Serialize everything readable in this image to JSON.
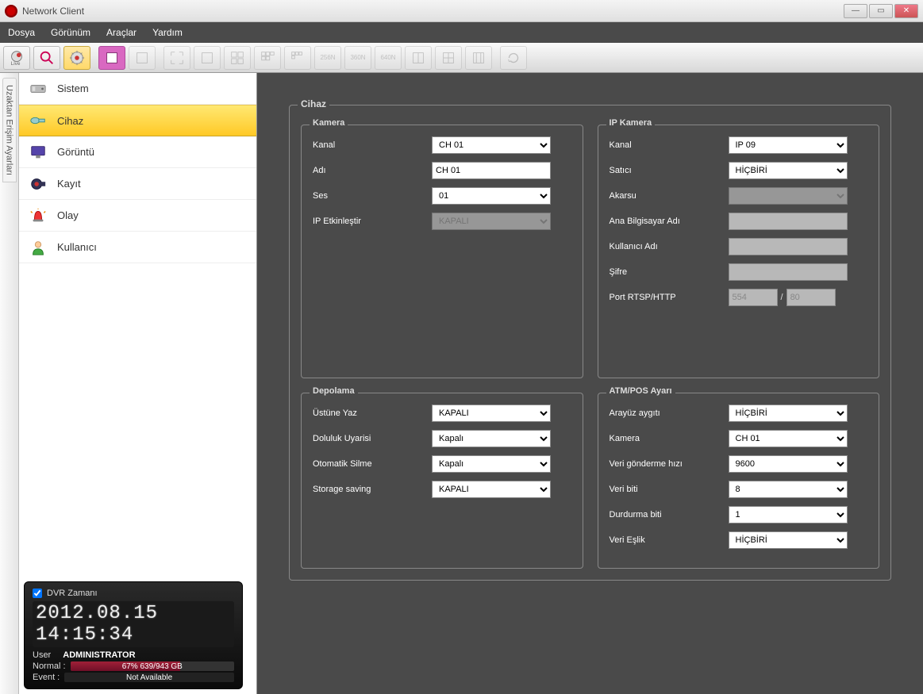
{
  "window": {
    "title": "Network Client"
  },
  "menu": {
    "file": "Dosya",
    "view": "Görünüm",
    "tools": "Araçlar",
    "help": "Yardım"
  },
  "vtab": {
    "label": "Uzaktan Erişim Ayarları"
  },
  "nav": {
    "items": [
      {
        "label": "Sistem"
      },
      {
        "label": "Cihaz"
      },
      {
        "label": "Görüntü"
      },
      {
        "label": "Kayıt"
      },
      {
        "label": "Olay"
      },
      {
        "label": "Kullanıcı"
      }
    ]
  },
  "status": {
    "checkbox_label": "DVR Zamanı",
    "clock": "2012.08.15 14:15:34",
    "user_label": "User",
    "user_value": "ADMINISTRATOR",
    "normal_label": "Normal :",
    "normal_value": "67% 639/943 GB",
    "event_label": "Event   :",
    "event_value": "Not Available"
  },
  "main": {
    "panel_title": "Cihaz",
    "kamera": {
      "legend": "Kamera",
      "kanal_label": "Kanal",
      "kanal_value": "CH 01",
      "adi_label": "Adı",
      "adi_value": "CH 01",
      "ses_label": "Ses",
      "ses_value": "01",
      "ip_label": "IP Etkinleştir",
      "ip_value": "KAPALI"
    },
    "ipkamera": {
      "legend": "IP Kamera",
      "kanal_label": "Kanal",
      "kanal_value": "IP 09",
      "satici_label": "Satıcı",
      "satici_value": "HİÇBİRİ",
      "akarsu_label": "Akarsu",
      "host_label": "Ana Bilgisayar Adı",
      "user_label": "Kullanıcı Adı",
      "pass_label": "Şifre",
      "port_label": "Port RTSP/HTTP",
      "port_rtsp": "554",
      "port_http": "80"
    },
    "depolama": {
      "legend": "Depolama",
      "ustune_label": "Üstüne Yaz",
      "ustune_value": "KAPALI",
      "doluluk_label": "Doluluk Uyarisi",
      "doluluk_value": "Kapalı",
      "silme_label": "Otomatik Silme",
      "silme_value": "Kapalı",
      "saving_label": "Storage saving",
      "saving_value": "KAPALI"
    },
    "atm": {
      "legend": "ATM/POS Ayarı",
      "arayuz_label": "Arayüz aygıtı",
      "arayuz_value": "HİÇBİRİ",
      "kamera_label": "Kamera",
      "kamera_value": "CH 01",
      "hiz_label": "Veri gönderme hızı",
      "hiz_value": "9600",
      "biti_label": "Veri biti",
      "biti_value": "8",
      "dur_label": "Durdurma biti",
      "dur_value": "1",
      "eslik_label": "Veri Eşlik",
      "eslik_value": "HİÇBİRİ"
    }
  }
}
